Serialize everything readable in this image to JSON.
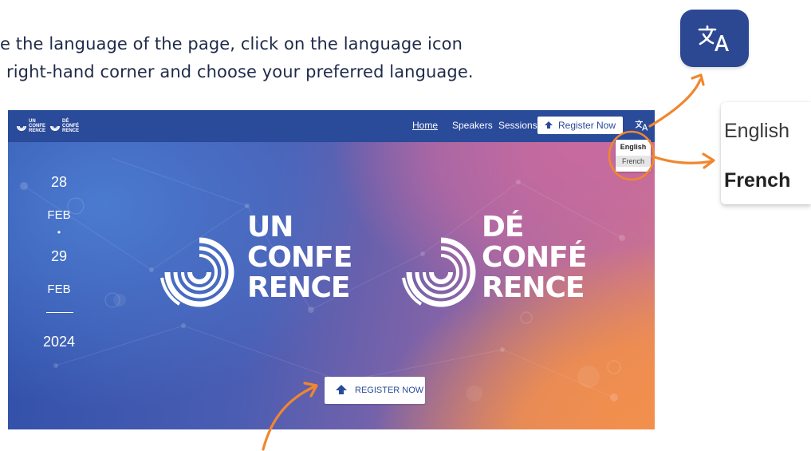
{
  "instruction": {
    "line1": "e the language of the page, click on the language icon",
    "line2": "right-hand corner and choose your preferred language."
  },
  "icons": {
    "translate": "translate-icon",
    "register": "ticket-icon"
  },
  "colors": {
    "brand_blue": "#2d4893",
    "nav_blue": "#2a4a9a",
    "accent_orange": "#f0872f",
    "text_dark": "#1f2a4a"
  },
  "zoomed_menu": {
    "english": "English",
    "french": "French"
  },
  "site": {
    "nav": {
      "home": "Home",
      "speakers": "Speakers",
      "sessions": "Sessions",
      "register": "Register Now"
    },
    "dropdown": {
      "english": "English",
      "french": "French"
    },
    "dates": {
      "day1": "28",
      "month1": "FEB",
      "separator": "•",
      "day2": "29",
      "month2": "FEB",
      "year": "2024"
    },
    "logo_en": {
      "line1": "UN",
      "line2": "CONFE",
      "line3": "RENCE"
    },
    "logo_fr": {
      "line1": "DÉ",
      "line2": "CONFÉ",
      "line3": "RENCE"
    },
    "hero_register": "REGISTER NOW"
  }
}
